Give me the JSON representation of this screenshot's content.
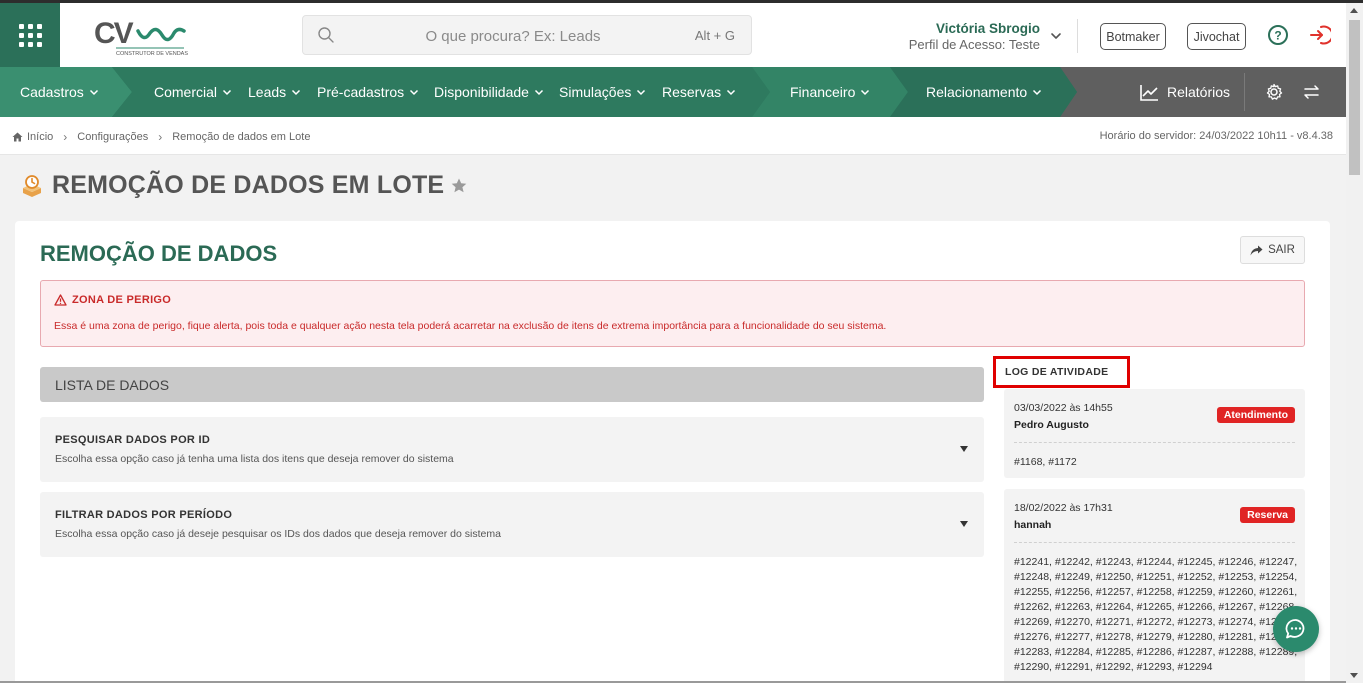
{
  "header": {
    "logo": {
      "text": "CV",
      "tagline": "CONSTRUTOR DE VENDAS"
    },
    "search": {
      "placeholder": "O que procura? Ex: Leads",
      "shortcut": "Alt + G"
    },
    "user": {
      "name": "Victória Sbrogio",
      "profile": "Perfil de Acesso: Teste"
    },
    "buttons": {
      "botmaker": "Botmaker",
      "jivochat": "Jivochat"
    }
  },
  "nav": {
    "items": [
      "Cadastros",
      "Comercial",
      "Leads",
      "Pré-cadastros",
      "Disponibilidade",
      "Simulações",
      "Reservas",
      "Financeiro",
      "Relacionamento"
    ],
    "reports": "Relatórios"
  },
  "breadcrumb": {
    "items": [
      "Início",
      "Configurações",
      "Remoção de dados em Lote"
    ],
    "server_time": "Horário do servidor: 24/03/2022 10h11 - v8.4.38"
  },
  "page": {
    "title": "REMOÇÃO DE DADOS EM LOTE"
  },
  "card": {
    "title": "REMOÇÃO DE DADOS",
    "exit_label": "SAIR",
    "danger": {
      "title": "ZONA DE PERIGO",
      "text": "Essa é uma zona de perigo, fique alerta, pois toda e qualquer ação nesta tela poderá acarretar na exclusão de itens de extrema importância para a funcionalidade do seu sistema."
    },
    "list_header": "LISTA DE DADOS",
    "options": [
      {
        "title": "PESQUISAR DADOS POR ID",
        "desc": "Escolha essa opção caso já tenha uma lista dos itens que deseja remover do sistema"
      },
      {
        "title": "FILTRAR DADOS POR PERÍODO",
        "desc": "Escolha essa opção caso já deseje pesquisar os IDs dos dados que deseja remover do sistema"
      }
    ],
    "log": {
      "title": "LOG DE ATIVIDADE",
      "entries": [
        {
          "date": "03/03/2022 às 14h55",
          "user": "Pedro Augusto",
          "badge": "Atendimento",
          "ids": "#1168, #1172"
        },
        {
          "date": "18/02/2022 às 17h31",
          "user": "hannah",
          "badge": "Reserva",
          "ids": "#12241, #12242, #12243, #12244, #12245, #12246, #12247, #12248, #12249, #12250, #12251, #12252, #12253, #12254, #12255, #12256, #12257, #12258, #12259, #12260, #12261, #12262, #12263, #12264, #12265, #12266, #12267, #12268, #12269, #12270, #12271, #12272, #12273, #12274, #12275, #12276, #12277, #12278, #12279, #12280, #12281, #12282, #12283, #12284, #12285, #12286, #12287, #12288, #12289, #12290, #12291, #12292, #12293, #12294"
        }
      ]
    }
  },
  "colors": {
    "brand_green": "#2b7059",
    "title_green": "#2b6a55",
    "danger_red": "#c92a2a",
    "badge_red": "#e02424",
    "nav_gray": "#5f5f5f"
  }
}
